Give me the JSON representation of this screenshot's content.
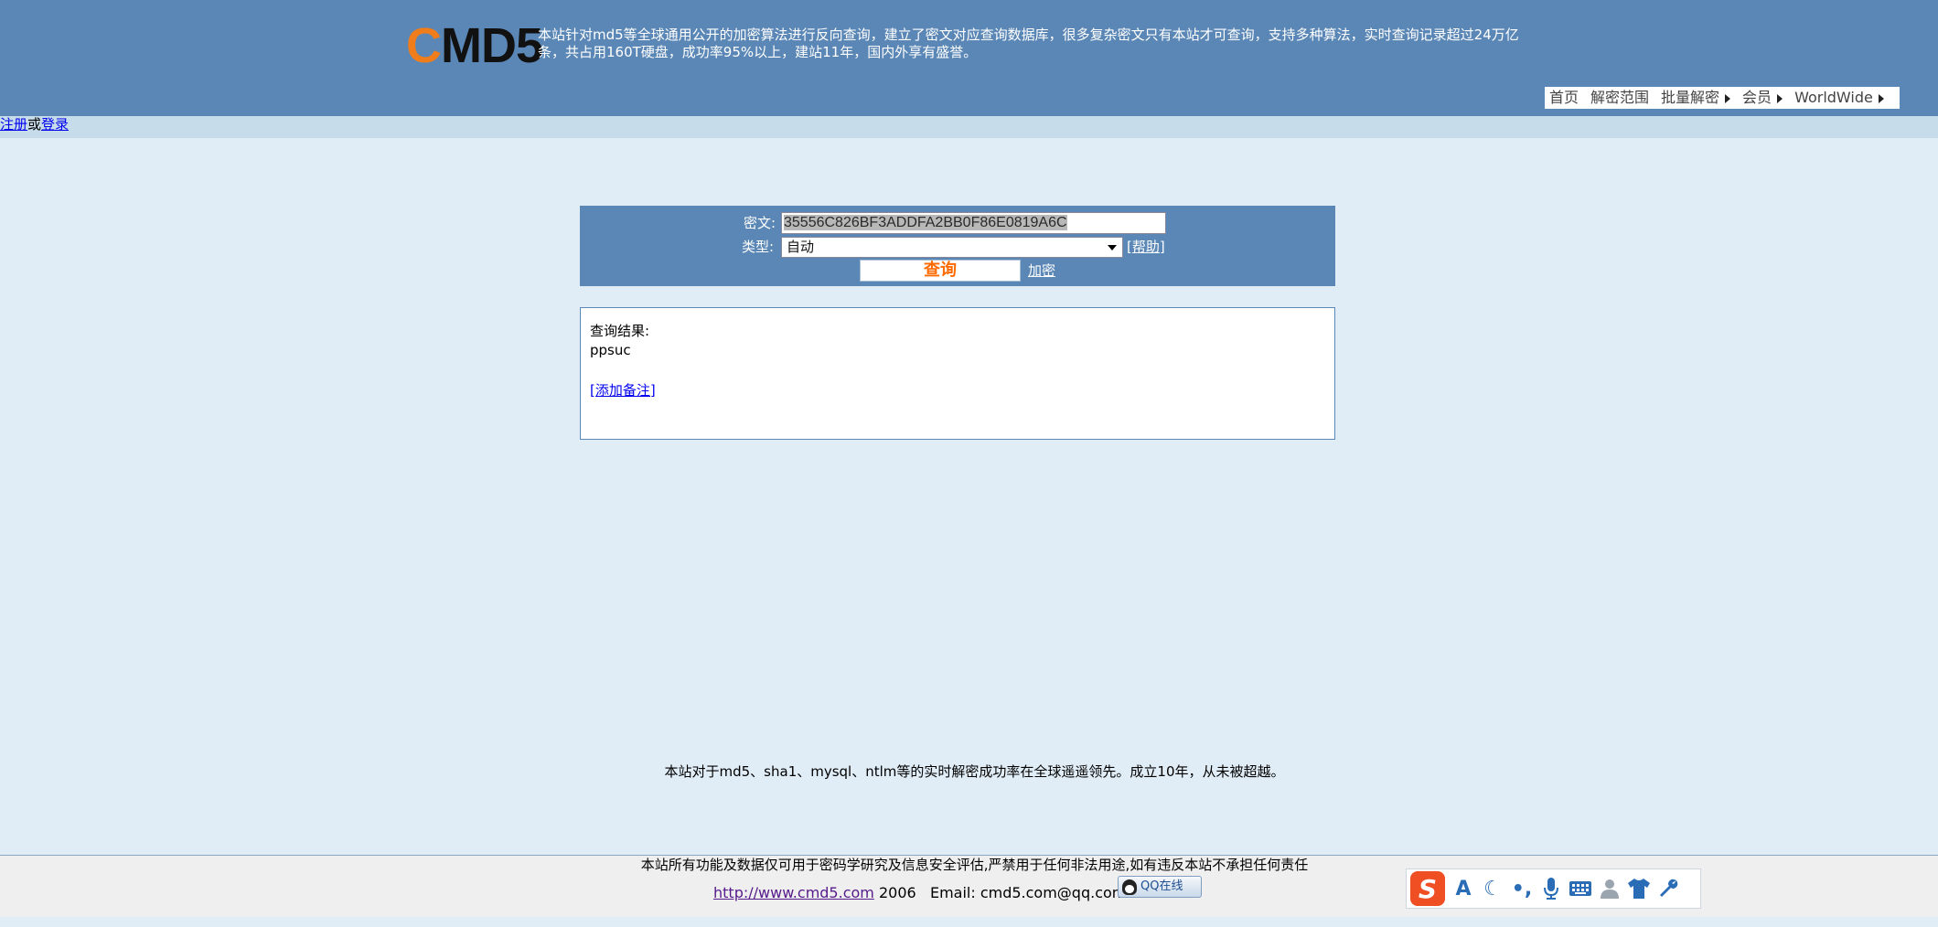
{
  "header": {
    "logo_c": "C",
    "logo_rest": "MD5",
    "intro": "本站针对md5等全球通用公开的加密算法进行反向查询，建立了密文对应查询数据库，很多复杂密文只有本站才可查询，支持多种算法，实时查询记录超过24万亿条，共占用160T硬盘，成功率95%以上，建站11年，国内外享有盛誉。",
    "nav": [
      {
        "label": "首页",
        "has_arrow": false
      },
      {
        "label": "解密范围",
        "has_arrow": false
      },
      {
        "label": "批量解密",
        "has_arrow": true
      },
      {
        "label": "会员",
        "has_arrow": true
      },
      {
        "label": "WorldWide",
        "has_arrow": true
      }
    ]
  },
  "auth": {
    "register": "注册",
    "or": "或",
    "login": "登录"
  },
  "search": {
    "cipher_label": "密文:",
    "cipher_value": "35556C826BF3ADDFA2BB0F86E0819A6C",
    "type_label": "类型:",
    "type_value": "自动",
    "help_link": "[帮助]",
    "query_button": "查询",
    "encrypt_link": "加密"
  },
  "result": {
    "title": "查询结果:",
    "value": "ppsuc",
    "add_note": "[添加备注]"
  },
  "tagline": "本站对于md5、sha1、mysql、ntlm等的实时解密成功率在全球遥遥领先。成立10年，从未被超越。",
  "footer": {
    "disclaimer": "本站所有功能及数据仅可用于密码学研究及信息安全评估,严禁用于任何非法用途,如有违反本站不承担任何责任",
    "site_url": "http://www.cmd5.com",
    "year": "2006",
    "email_label": "Email:",
    "email": "cmd5.com@qq.com",
    "qq_badge": "QQ在线"
  },
  "ime_toolbar": {
    "icons": [
      "sogou-logo-icon",
      "font-a-icon",
      "moon-icon",
      "punctuation-icon",
      "microphone-icon",
      "keyboard-icon",
      "user-icon",
      "skin-shirt-icon",
      "wrench-icon"
    ]
  },
  "colors": {
    "header_bg": "#5b87b6",
    "page_bg": "#e1edf6",
    "subbar_bg": "#c6dceb",
    "logo_accent": "#f07d1c",
    "query_button_text": "#ff6a00",
    "footer_bg": "#efefef"
  }
}
